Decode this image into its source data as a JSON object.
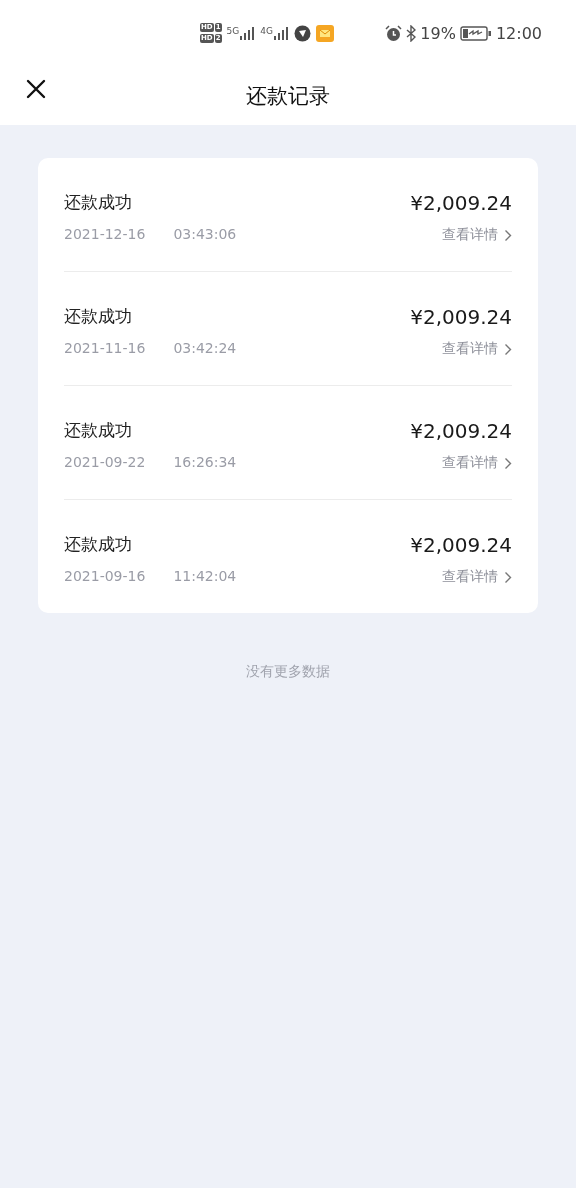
{
  "status_bar": {
    "sims": [
      {
        "label": "HD",
        "slot": "1"
      },
      {
        "label": "HD",
        "slot": "2"
      }
    ],
    "networks": [
      {
        "label": "5G"
      },
      {
        "label": "4G"
      }
    ],
    "battery": "19%",
    "time": "12:00"
  },
  "header": {
    "title": "还款记录"
  },
  "records": [
    {
      "status": "还款成功",
      "date": "2021-12-16",
      "time": "03:43:06",
      "amount": "¥2,009.24",
      "link": "查看详情"
    },
    {
      "status": "还款成功",
      "date": "2021-11-16",
      "time": "03:42:24",
      "amount": "¥2,009.24",
      "link": "查看详情"
    },
    {
      "status": "还款成功",
      "date": "2021-09-22",
      "time": "16:26:34",
      "amount": "¥2,009.24",
      "link": "查看详情"
    },
    {
      "status": "还款成功",
      "date": "2021-09-16",
      "time": "11:42:04",
      "amount": "¥2,009.24",
      "link": "查看详情"
    }
  ],
  "footer": "没有更多数据"
}
